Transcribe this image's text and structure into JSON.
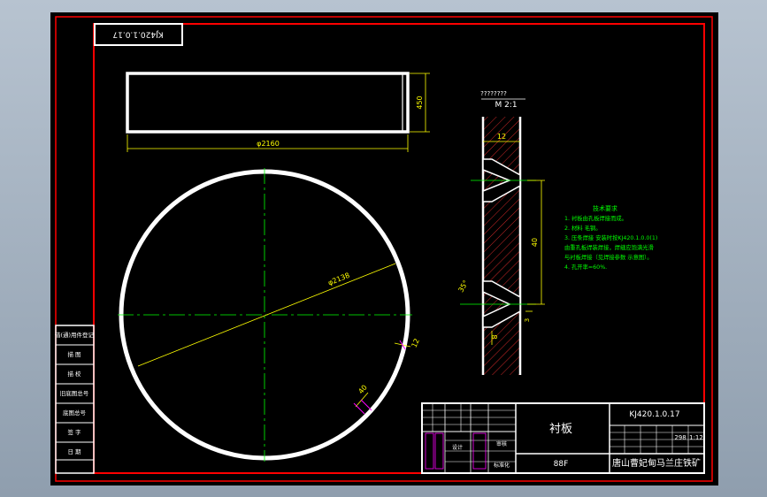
{
  "colors": {
    "background": "#000000",
    "border_red": "#ff0000",
    "outline_white": "#ffffff",
    "dimension_yellow": "#ffff00",
    "center_green": "#00ff00",
    "note_green": "#00ff00",
    "hatch_red": "#ff3030",
    "dim_magenta": "#ff00ff"
  },
  "drawing_code_box": "KJ420.1.0.17",
  "top_view": {
    "width_dim": "φ2160",
    "height_dim": "450"
  },
  "circle_view": {
    "diameter_dim": "φ2138",
    "thickness_dim": "12",
    "edge_dim": "40"
  },
  "section_view": {
    "label": "M 2:1",
    "tag": "????????",
    "thickness_dim": "12",
    "hole_pitch_dim": "40",
    "angle_dim": "35°",
    "slot_dim": "8",
    "small_dim": "3"
  },
  "notes": {
    "title": "技术要求",
    "lines": [
      "1. 衬板由孔板焊接而成。",
      "2. 材料 毛钢。",
      "3. 压条焊接 安装时按KJ420.1.0.0(1)",
      "   由重孔板焊装焊接，焊缝应饱满光滑",
      "   与衬板焊接（见焊接参数 示意图）。",
      "4. 孔开率=60%."
    ]
  },
  "side_stamp": {
    "rows": [
      "借(通)用件登记",
      "描 图",
      "描 校",
      "旧底图总号",
      "底图总号",
      "签 字",
      "日 期"
    ]
  },
  "title_block": {
    "part_name": "衬板",
    "drawing_no": "KJ420.1.0.17",
    "material": "88F",
    "company": "唐山曹妃甸马兰庄铁矿",
    "mass": "298",
    "scale": "1:12",
    "sheet": "",
    "small_labels": [
      "设计",
      "标准化",
      "审核"
    ]
  }
}
